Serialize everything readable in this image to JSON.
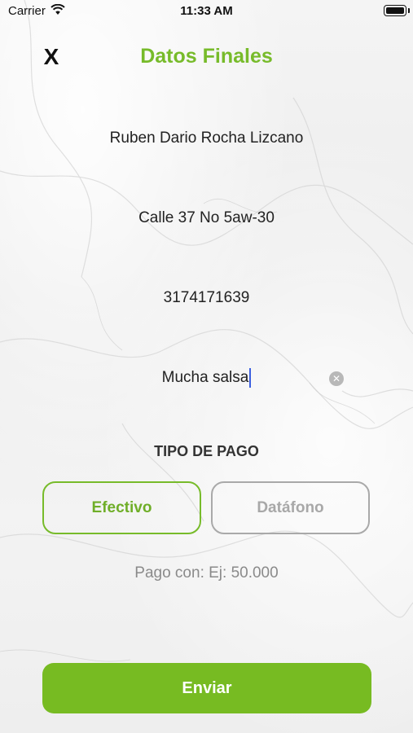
{
  "status_bar": {
    "carrier": "Carrier",
    "time": "11:33 AM",
    "wifi_icon": "wifi-icon",
    "battery_icon": "battery-icon"
  },
  "header": {
    "close_label": "X",
    "title": "Datos Finales"
  },
  "form": {
    "name": "Ruben Dario Rocha Lizcano",
    "address": "Calle 37 No 5aw-30",
    "phone": "3174171639",
    "note": "Mucha salsa",
    "clear_icon": "clear-icon"
  },
  "payment": {
    "section_label": "TIPO DE PAGO",
    "options": [
      {
        "label": "Efectivo",
        "selected": true
      },
      {
        "label": "Datáfono",
        "selected": false
      }
    ],
    "amount_placeholder": "Pago con: Ej: 50.000"
  },
  "actions": {
    "submit_label": "Enviar"
  },
  "colors": {
    "accent": "#77bb22",
    "inactive": "#a9a9a9"
  }
}
